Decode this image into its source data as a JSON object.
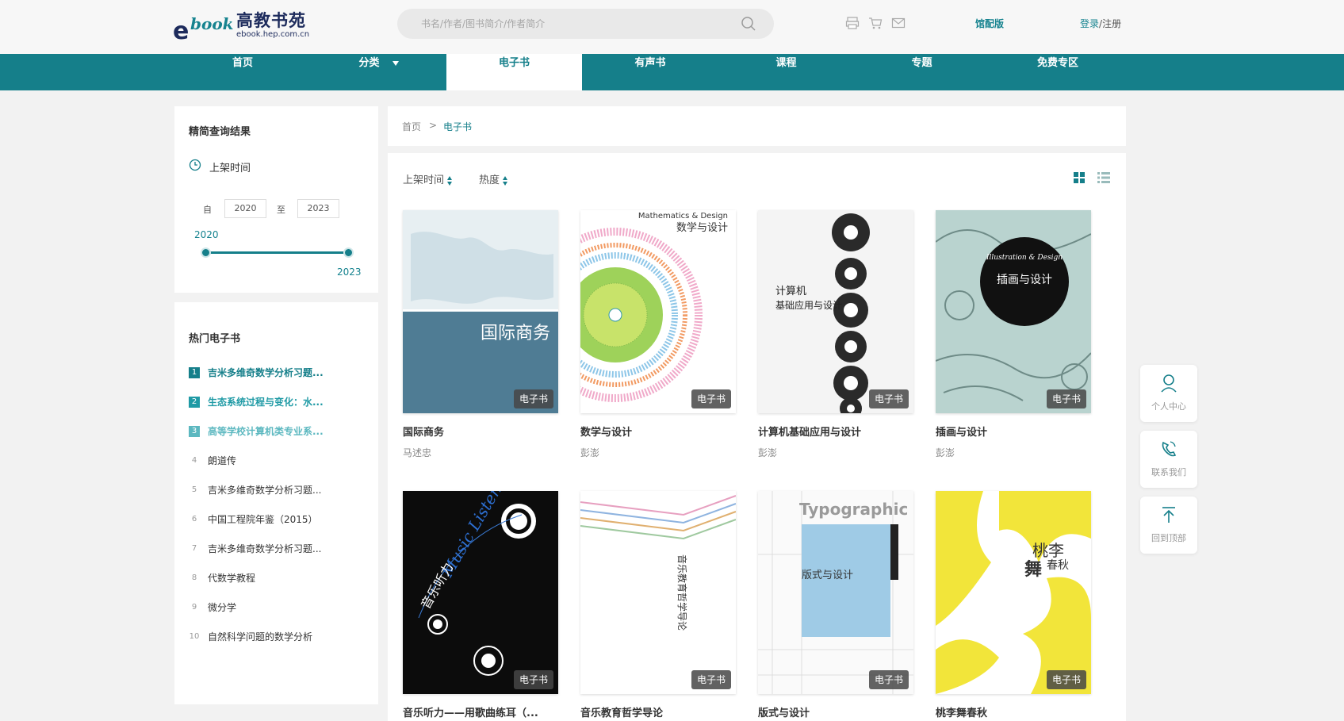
{
  "header": {
    "brand": "高教书苑",
    "brand_url": "ebook.hep.com.cn",
    "search_placeholder": "书名/作者/图书简介/作者简介",
    "library_label": "馆配版",
    "login_label": "登录",
    "register_label": "注册",
    "icons": [
      "print-icon",
      "cart-icon",
      "mail-icon",
      "search-icon"
    ]
  },
  "nav": {
    "items": [
      {
        "label": "首页"
      },
      {
        "label": "分类"
      },
      {
        "label": "电子书"
      },
      {
        "label": "有声书"
      },
      {
        "label": "课程"
      },
      {
        "label": "专题"
      },
      {
        "label": "免费专区"
      }
    ],
    "active": "电子书"
  },
  "filter": {
    "title": "精简查询结果",
    "time_label": "上架时间",
    "from_label": "自",
    "to_label": "至",
    "from_year": "2020",
    "to_year": "2023",
    "slider_min": "2020",
    "slider_max": "2023"
  },
  "hot": {
    "title": "热门电子书",
    "items": [
      {
        "rank": "1",
        "label": "吉米多维奇数学分析习题..."
      },
      {
        "rank": "2",
        "label": "生态系统过程与变化：水..."
      },
      {
        "rank": "3",
        "label": "高等学校计算机类专业系..."
      },
      {
        "rank": "4",
        "label": "朗道传"
      },
      {
        "rank": "5",
        "label": "吉米多维奇数学分析习题..."
      },
      {
        "rank": "6",
        "label": "中国工程院年鉴（2015）"
      },
      {
        "rank": "7",
        "label": "吉米多维奇数学分析习题..."
      },
      {
        "rank": "8",
        "label": "代数学教程"
      },
      {
        "rank": "9",
        "label": "微分学"
      },
      {
        "rank": "10",
        "label": "自然科学问题的数学分析"
      }
    ]
  },
  "breadcrumb": {
    "home": "首页",
    "sep": ">",
    "current": "电子书"
  },
  "sort": {
    "by_time": "上架时间",
    "by_popularity": "热度"
  },
  "badge_label": "电子书",
  "books": [
    {
      "title": "国际商务",
      "author": "马述忠",
      "cover_text": "国际商务"
    },
    {
      "title": "数学与设计",
      "author": "彭澎",
      "cover_text": "数学与设计",
      "cover_sub": "Mathematics & Design"
    },
    {
      "title": "计算机基础应用与设计",
      "author": "彭澎",
      "cover_text": "计算机",
      "cover_text2": "基础应用与设计"
    },
    {
      "title": "插画与设计",
      "author": "彭澎",
      "cover_text": "插画与设计",
      "cover_sub": "Illustration & Design"
    },
    {
      "title": "音乐听力——用歌曲练耳（...",
      "author": "",
      "cover_text": "音乐听力",
      "cover_sub": "Music Listening"
    },
    {
      "title": "音乐教育哲学导论",
      "author": "",
      "cover_text": "音乐教育哲学导论"
    },
    {
      "title": "版式与设计",
      "author": "",
      "cover_text": "版式与设计",
      "cover_sub": "Typographic Design"
    },
    {
      "title": "桃李舞春秋",
      "author": "",
      "cover_text": "桃李",
      "cover_text2": "舞",
      "cover_text3": "春秋"
    }
  ],
  "float_bar": [
    {
      "label": "个人中心"
    },
    {
      "label": "联系我们"
    },
    {
      "label": "回到顶部"
    }
  ],
  "colors": {
    "primary": "#157f8a",
    "navy": "#1d2b5c"
  }
}
